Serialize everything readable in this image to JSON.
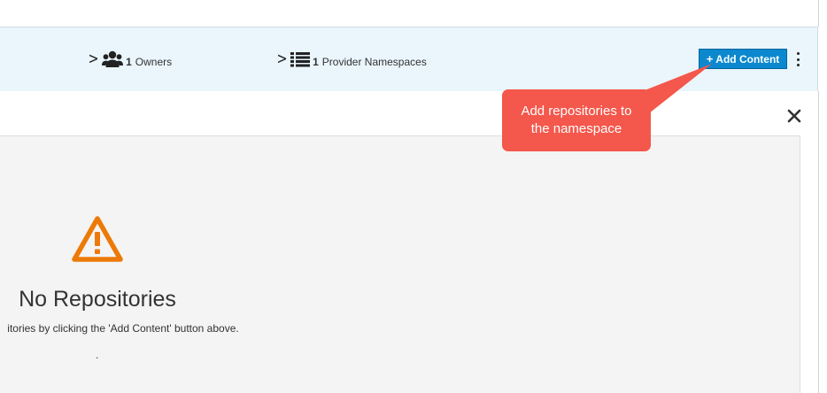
{
  "header": {
    "owners": {
      "icon": "users-icon",
      "count": "1",
      "label": "Owners"
    },
    "namespaces": {
      "icon": "list-icon",
      "count": "1",
      "label": "Provider Namespaces"
    },
    "add_button": {
      "plus": "+",
      "label": "Add Content"
    },
    "kebab_icon": "kebab-menu-icon"
  },
  "callout": {
    "text": "Add repositories to the namespace"
  },
  "content": {
    "close_icon": "close-icon",
    "empty_state": {
      "icon": "warning-triangle-icon",
      "title": "No Repositories",
      "description": "itories by clicking the 'Add Content' button above.",
      "trailing": "."
    }
  },
  "colors": {
    "header_bg": "#eaf5fc",
    "primary_button": "#0b88ce",
    "callout_bg": "#f4574b",
    "warning": "#ec7a08",
    "panel_bg": "#f4f4f4"
  }
}
